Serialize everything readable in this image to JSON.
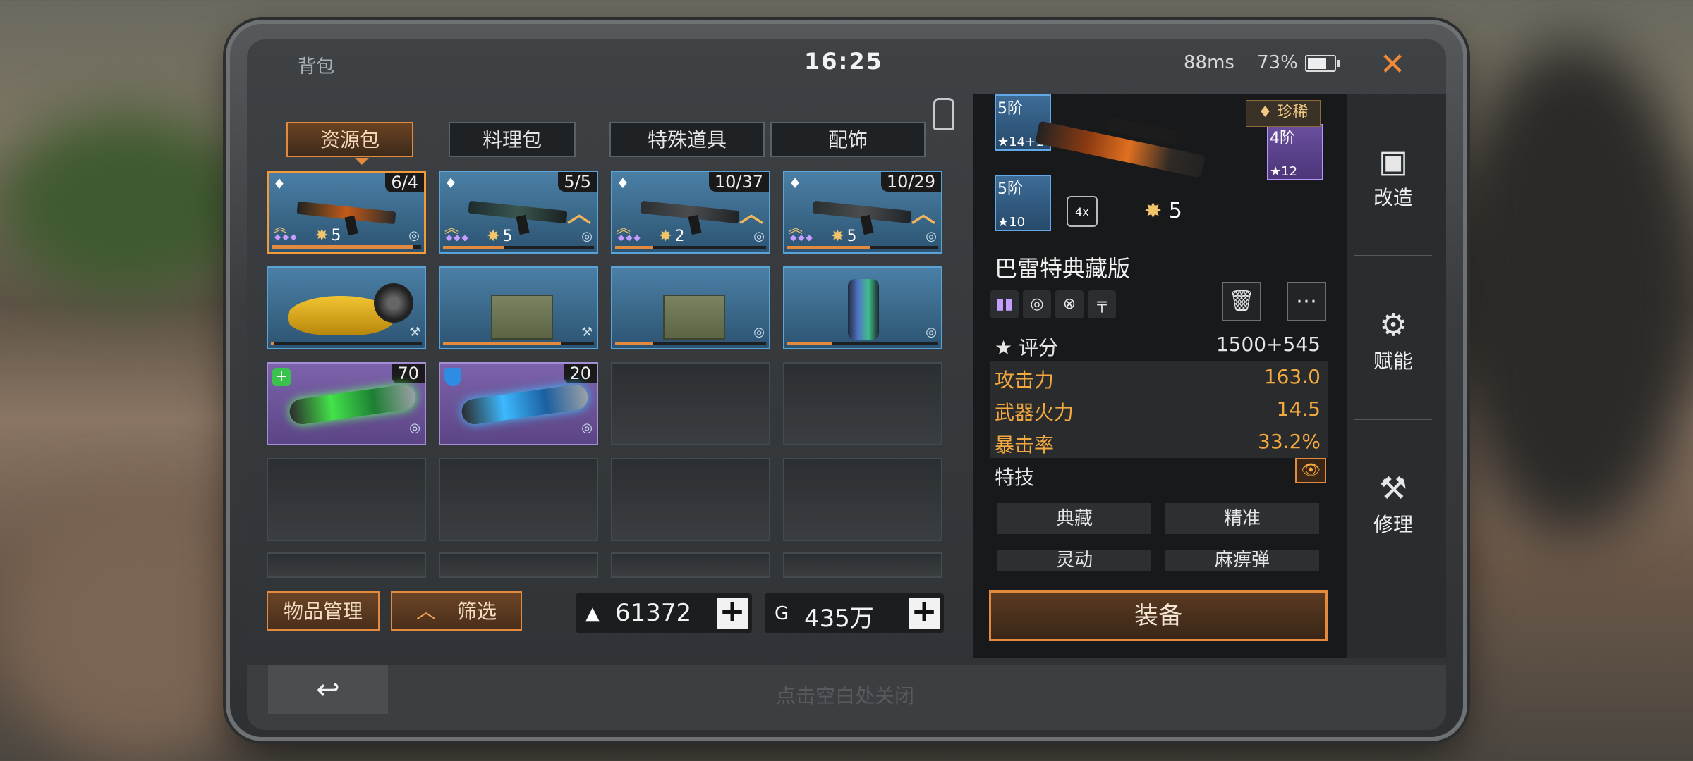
{
  "header": {
    "title": "背包",
    "clock": "16:25",
    "ping": "88ms",
    "battery": "73%",
    "battery_level": 0.73,
    "close_icon": "close-icon"
  },
  "tabs": [
    {
      "label": "资源包",
      "active": true
    },
    {
      "label": "料理包",
      "active": false
    },
    {
      "label": "特殊道具",
      "active": false
    },
    {
      "label": "配饰",
      "active": false
    }
  ],
  "grid": {
    "rows": [
      [
        {
          "type": "weapon",
          "count": "6/4",
          "level": "5",
          "selected": true
        },
        {
          "type": "weapon",
          "count": "5/5",
          "level": "5"
        },
        {
          "type": "weapon",
          "count": "10/37",
          "level": "2"
        },
        {
          "type": "weapon",
          "count": "10/29",
          "level": "5"
        }
      ],
      [
        {
          "type": "vehicle"
        },
        {
          "type": "crate"
        },
        {
          "type": "crate"
        },
        {
          "type": "canister"
        }
      ],
      [
        {
          "type": "syringe-heal",
          "count": "70"
        },
        {
          "type": "syringe-shield",
          "count": "20"
        }
      ]
    ]
  },
  "bottom_left": {
    "manage_label": "物品管理",
    "filter_label": "筛选",
    "currency1": "61372",
    "currency2": "435万"
  },
  "detail": {
    "parts": [
      {
        "tier": "5阶",
        "level": "14+1"
      },
      {
        "tier": "5阶",
        "level": "10"
      },
      {
        "tier": "4阶",
        "level": "12"
      }
    ],
    "scope_label": "4x",
    "weapon_level": "5",
    "rarity": "珍稀",
    "weapon_name": "巴雷特典藏版",
    "score_label": "评分",
    "score_value": "1500+545",
    "stats": [
      {
        "label": "攻击力",
        "value": "163.0"
      },
      {
        "label": "武器火力",
        "value": "14.5"
      },
      {
        "label": "暴击率",
        "value": "33.2%"
      }
    ],
    "traits_label": "特技",
    "traits": [
      "典藏",
      "精准",
      "灵动",
      "麻痹弹"
    ],
    "equip_label": "装备"
  },
  "side_actions": [
    {
      "label": "改造"
    },
    {
      "label": "赋能"
    },
    {
      "label": "修理"
    }
  ],
  "footer": {
    "hint": "点击空白处关闭"
  }
}
